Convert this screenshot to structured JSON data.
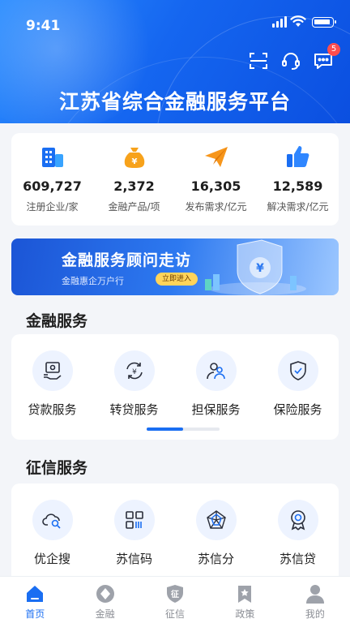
{
  "status_bar": {
    "time": "9:41"
  },
  "header": {
    "title": "江苏省综合金融服务平台",
    "message_badge": "5",
    "icons": [
      "scan-icon",
      "customer-service-icon",
      "message-icon"
    ]
  },
  "stats": [
    {
      "icon": "building-icon",
      "value": "609,727",
      "label": "注册企业/家"
    },
    {
      "icon": "money-bag-icon",
      "value": "2,372",
      "label": "金融产品/项"
    },
    {
      "icon": "paper-plane-icon",
      "value": "16,305",
      "label": "发布需求/亿元"
    },
    {
      "icon": "thumbs-up-icon",
      "value": "12,589",
      "label": "解决需求/亿元"
    }
  ],
  "banner": {
    "title": "金融服务顾问走访",
    "subtitle": "金融惠企万户行",
    "button": "立即进入"
  },
  "finance_services": {
    "title": "金融服务",
    "items": [
      {
        "icon": "loan-icon",
        "label": "贷款服务"
      },
      {
        "icon": "refinance-icon",
        "label": "转贷服务"
      },
      {
        "icon": "guarantee-icon",
        "label": "担保服务"
      },
      {
        "icon": "insurance-shield-icon",
        "label": "保险服务"
      }
    ],
    "page_progress": 0.5
  },
  "credit_services": {
    "title": "征信服务",
    "items": [
      {
        "icon": "cloud-search-icon",
        "label": "优企搜"
      },
      {
        "icon": "qr-code-icon",
        "label": "苏信码"
      },
      {
        "icon": "radar-chart-icon",
        "label": "苏信分"
      },
      {
        "icon": "badge-medal-icon",
        "label": "苏信贷"
      }
    ]
  },
  "tabbar": {
    "active": "home",
    "tabs": [
      {
        "id": "home",
        "label": "首页"
      },
      {
        "id": "finance",
        "label": "金融"
      },
      {
        "id": "credit",
        "label": "征信"
      },
      {
        "id": "policy",
        "label": "政策"
      },
      {
        "id": "mine",
        "label": "我的"
      }
    ]
  },
  "colors": {
    "primary": "#1a6ef2",
    "badge": "#ff4d4f",
    "accent_orange": "#f7a21b"
  }
}
